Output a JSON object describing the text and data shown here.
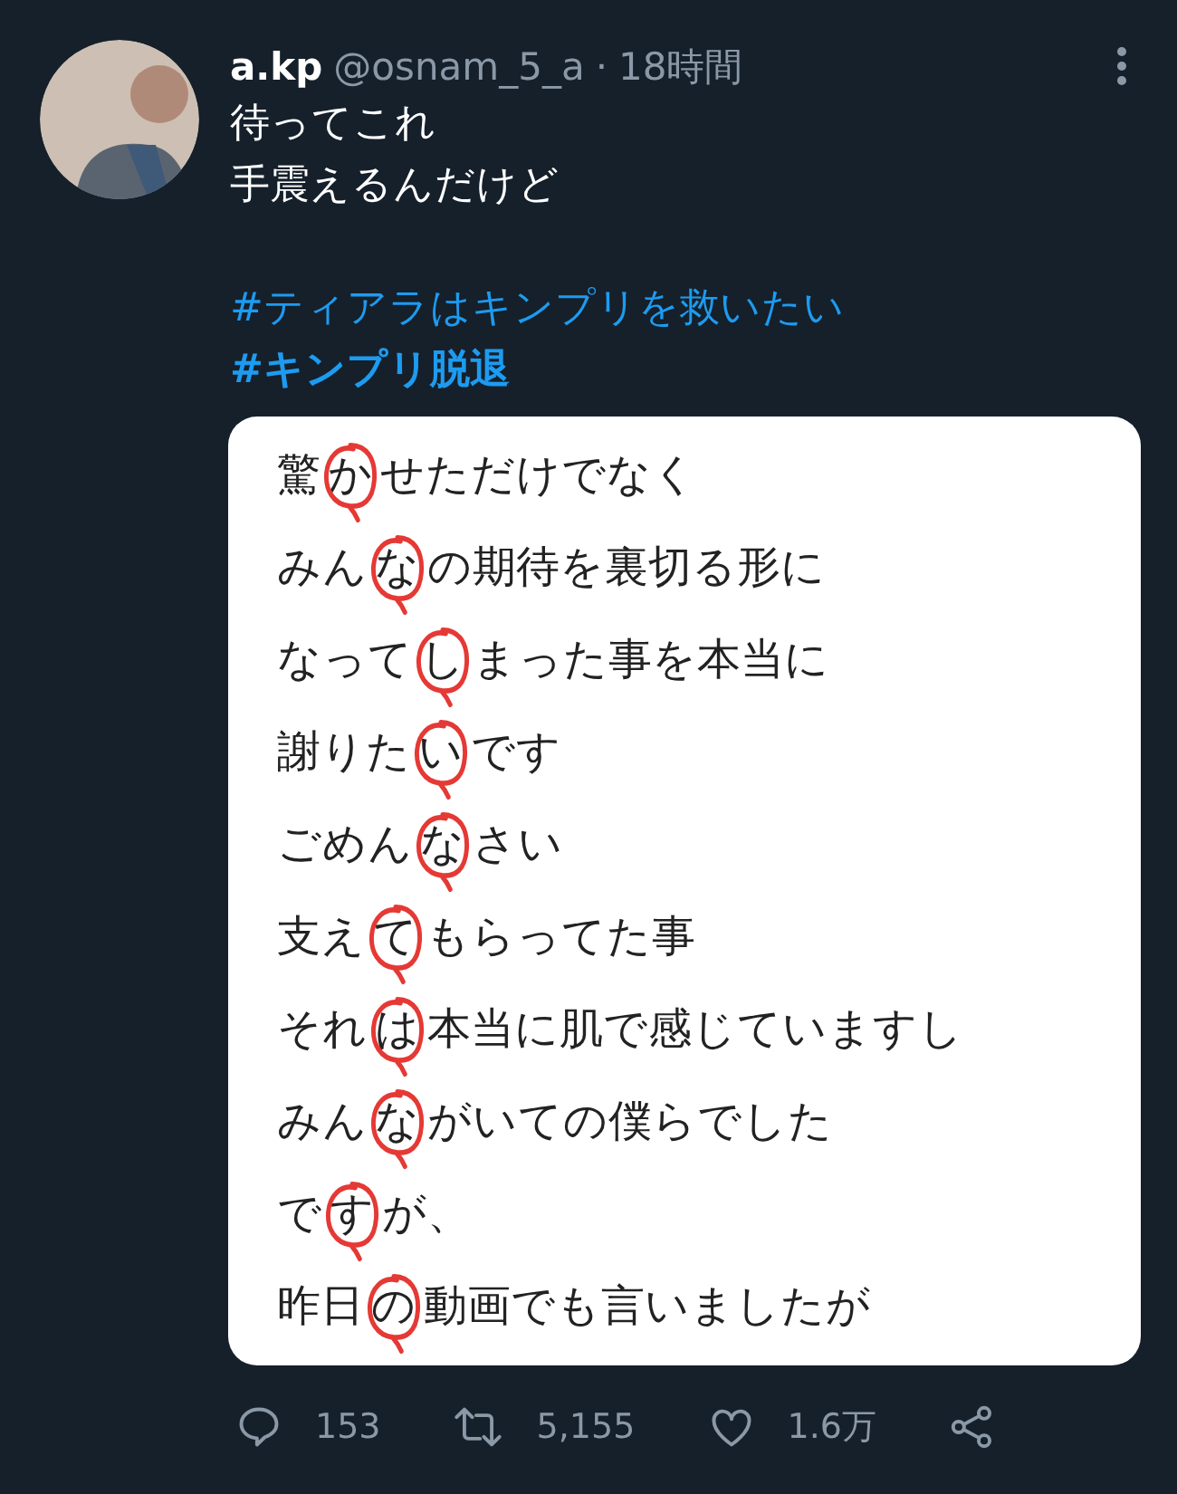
{
  "tweet": {
    "display_name": "a.kp",
    "handle": "@osnam_5_a",
    "separator": "·",
    "time": "18時間",
    "text_lines": [
      "待ってこれ",
      "手震えるんだけど"
    ],
    "hashtags": [
      {
        "text": "#ティアラはキンプリを救いたい",
        "bold": false
      },
      {
        "text": "#キンプリ脱退",
        "bold": true
      }
    ],
    "image": {
      "lines": [
        {
          "before": "驚",
          "circled": "か",
          "after": "せただけでなく"
        },
        {
          "before": "みん",
          "circled": "な",
          "after": "の期待を裏切る形に"
        },
        {
          "before": "なって",
          "circled": "し",
          "after": "まった事を本当に"
        },
        {
          "before": "謝りた",
          "circled": "い",
          "after": "です"
        },
        {
          "before": "ごめん",
          "circled": "な",
          "after": "さい"
        },
        {
          "before": "支え",
          "circled": "て",
          "after": "もらってた事"
        },
        {
          "before": "それ",
          "circled": "は",
          "after": "本当に肌で感じていますし"
        },
        {
          "before": "みん",
          "circled": "な",
          "after": "がいての僕らでした"
        },
        {
          "before": "で",
          "circled": "す",
          "after": "が、"
        },
        {
          "before": "昨日",
          "circled": "の",
          "after": "動画でも言いましたが"
        }
      ]
    },
    "actions": [
      {
        "kind": "reply",
        "count": "153"
      },
      {
        "kind": "retweet",
        "count": "5,155"
      },
      {
        "kind": "like",
        "count": "1.6万"
      },
      {
        "kind": "share"
      }
    ]
  }
}
